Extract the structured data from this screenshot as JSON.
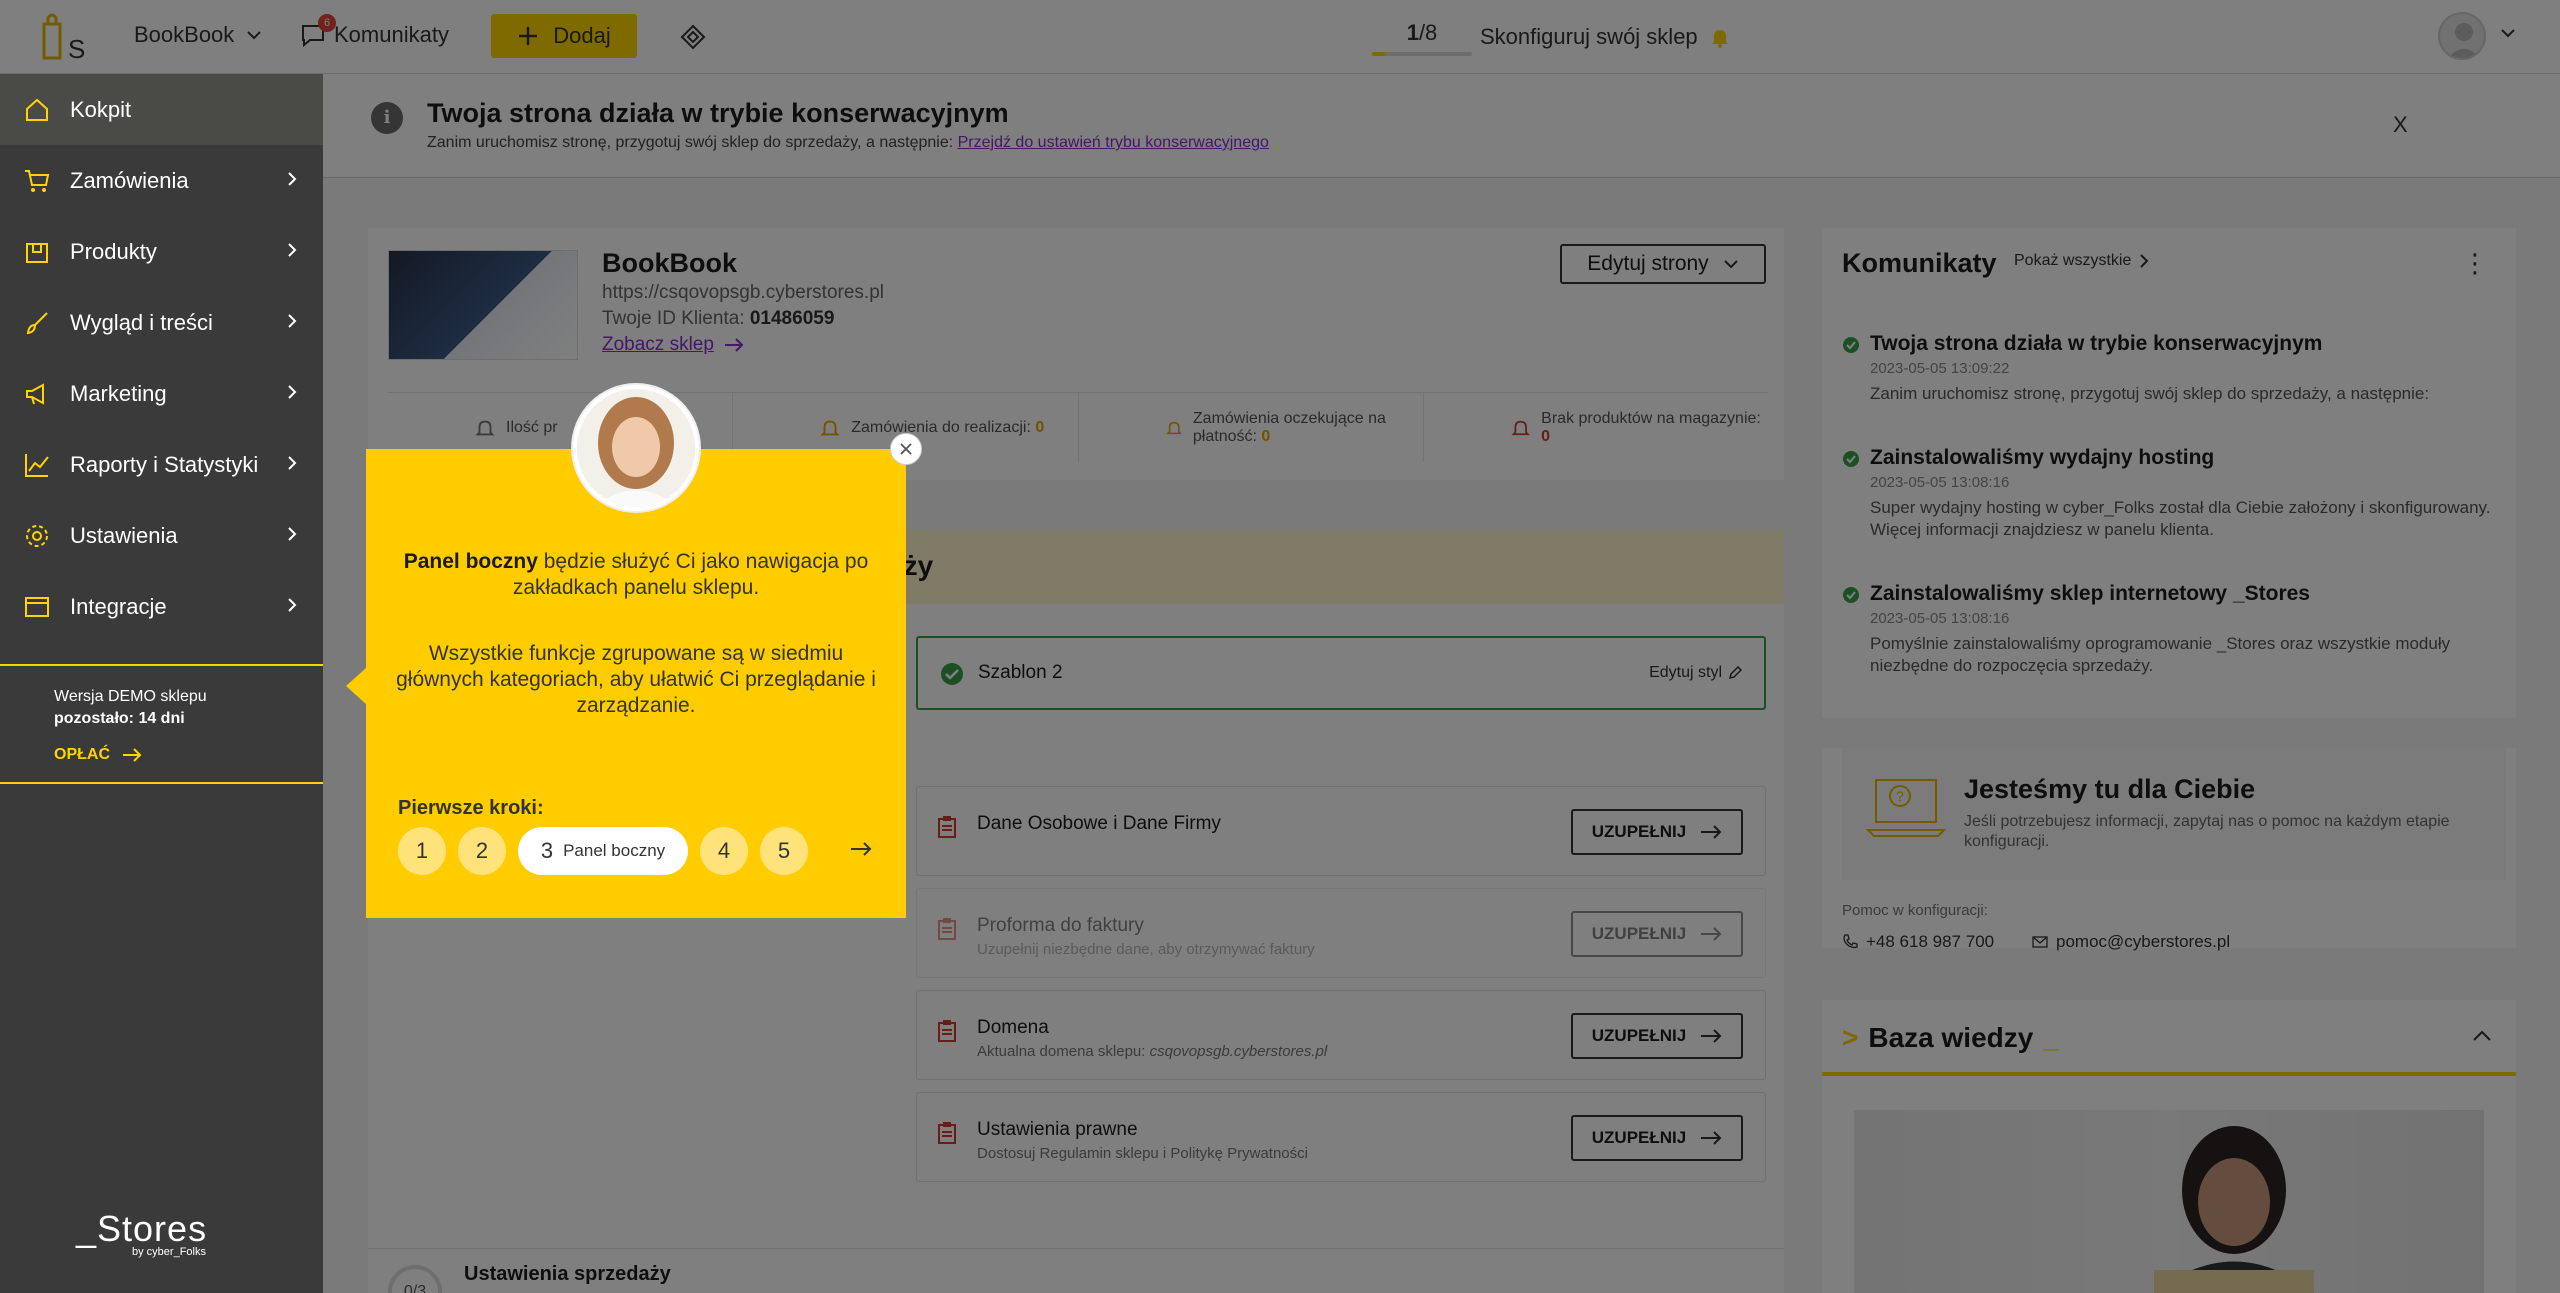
{
  "topbar": {
    "store_name": "BookBook",
    "messages_label": "Komunikaty",
    "messages_count": "6",
    "add_label": "Dodaj",
    "progress_current": "1",
    "progress_total": "/8",
    "progress_fraction": 0.125,
    "configure_label": "Skonfiguruj swój sklep"
  },
  "sidebar": {
    "items": [
      {
        "label": "Kokpit",
        "icon": "home-icon"
      },
      {
        "label": "Zamówienia",
        "icon": "cart-icon"
      },
      {
        "label": "Produkty",
        "icon": "box-icon"
      },
      {
        "label": "Wygląd i treści",
        "icon": "brush-icon"
      },
      {
        "label": "Marketing",
        "icon": "megaphone-icon"
      },
      {
        "label": "Raporty i Statystyki",
        "icon": "chart-icon"
      },
      {
        "label": "Ustawienia",
        "icon": "gear-icon"
      },
      {
        "label": "Integracje",
        "icon": "window-icon"
      }
    ],
    "demo_line1": "Wersja DEMO sklepu",
    "demo_line2": "pozostało: 14 dni",
    "pay_label": "OPŁAĆ",
    "brand": "_Stores",
    "brand_by": "by cyber_Folks"
  },
  "banner": {
    "title": "Twoja strona działa w trybie konserwacyjnym",
    "subtitle": "Zanim uruchomisz stronę, przygotuj swój sklep do sprzedaży, a następnie:",
    "link": "Przejdź do ustawień trybu konserwacyjnego",
    "close": "X"
  },
  "store": {
    "name": "BookBook",
    "url": "https://csqovopsgb.cyberstores.pl",
    "client_id_label": "Twoje ID Klienta:",
    "client_id": "01486059",
    "see_label": "Zobacz sklep",
    "edit_pages": "Edytuj strony",
    "stats": [
      {
        "label": "Ilość pr",
        "value": "",
        "cls": ""
      },
      {
        "label": "Zamówienia do realizacji:",
        "value": "0",
        "cls": ""
      },
      {
        "label": "Zamówienia oczekujące na płatność:",
        "value": "0",
        "cls": ""
      },
      {
        "label": "Brak produktów na magazynie:",
        "value": "0",
        "cls": "red"
      }
    ]
  },
  "setup": {
    "title": "aży",
    "template_name": "Szablon 2",
    "edit_style": "Edytuj styl",
    "tasks": [
      {
        "title": "Dane Osobowe i Dane Firmy",
        "sub": "",
        "sub_em": "",
        "button": "UZUPEŁNIJ",
        "muted": false
      },
      {
        "title": "Proforma do faktury",
        "sub": "Uzupełnij niezbędne dane, aby otrzymywać faktury",
        "sub_em": "",
        "button": "UZUPEŁNIJ",
        "muted": true
      },
      {
        "title": "Domena",
        "sub": "Aktualna domena sklepu: ",
        "sub_em": "csqovopsgb.cyberstores.pl",
        "button": "UZUPEŁNIJ",
        "muted": false
      },
      {
        "title": "Ustawienia prawne",
        "sub": "Dostosuj Regulamin sklepu i Politykę Prywatności",
        "sub_em": "",
        "button": "UZUPEŁNIJ",
        "muted": false
      }
    ],
    "sales_count": "0/3",
    "sales_title": "Ustawienia sprzedaży"
  },
  "news": {
    "title": "Komunikaty",
    "show_all": "Pokaż wszystkie",
    "items": [
      {
        "title": "Twoja strona działa w trybie konserwacyjnym",
        "date": "2023-05-05 13:09:22",
        "body": "Zanim uruchomisz stronę, przygotuj swój sklep do sprzedaży, a następnie:"
      },
      {
        "title": "Zainstalowaliśmy wydajny hosting",
        "date": "2023-05-05 13:08:16",
        "body": "Super wydajny hosting w cyber_Folks został dla Ciebie założony i skonfigurowany. Więcej informacji znajdziesz w panelu klienta."
      },
      {
        "title": "Zainstalowaliśmy sklep internetowy _Stores",
        "date": "2023-05-05 13:08:16",
        "body": "Pomyślnie zainstalowaliśmy oprogramowanie _Stores oraz wszystkie moduły niezbędne do rozpoczęcia sprzedaży."
      }
    ]
  },
  "help": {
    "title": "Jesteśmy tu dla Ciebie",
    "subtitle": "Jeśli potrzebujesz informacji, zapytaj nas o pomoc na każdym etapie konfiguracji.",
    "label": "Pomoc w konfiguracji:",
    "phone": "+48 618 987 700",
    "email": "pomoc@cyberstores.pl"
  },
  "kb": {
    "title": "Baza wiedzy"
  },
  "tour": {
    "p1_bold": "Panel boczny",
    "p1_rest": " będzie służyć Ci jako nawigacja po zakładkach panelu sklepu.",
    "p2": "Wszystkie funkcje zgrupowane są w siedmiu głównych kategoriach, aby ułatwić Ci przeglądanie i zarządzanie.",
    "steps_label": "Pierwsze kroki:",
    "steps": [
      "1",
      "2",
      "3",
      "4",
      "5"
    ],
    "active_step_label": "Panel boczny"
  },
  "colors": {
    "accent": "#ffcc00",
    "sidebar": "#3a3a3a",
    "link": "#8b2fc9",
    "success": "#39a048",
    "danger": "#d23b2e"
  }
}
